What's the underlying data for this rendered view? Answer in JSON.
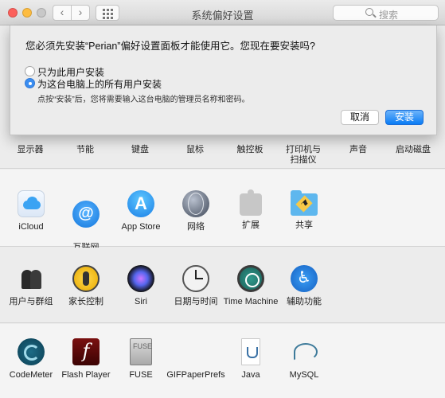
{
  "window": {
    "title": "系统偏好设置",
    "search_placeholder": "搜索"
  },
  "nav": {
    "back": "‹",
    "forward": "›"
  },
  "dialog": {
    "message": "您必须先安装“Perian”偏好设置面板才能使用它。您现在要安装吗?",
    "option_current_user": "只为此用户安装",
    "option_all_users": "为这台电脑上的所有用户安装",
    "selected": "all_users",
    "hint": "点按“安装”后，您将需要输入这台电脑的管理员名称和密码。",
    "cancel": "取消",
    "install": "安装"
  },
  "row1": [
    "显示器",
    "节能",
    "键盘",
    "鼠标",
    "触控板",
    "打印机与\n扫描仪",
    "声音",
    "启动磁盘"
  ],
  "row2": [
    {
      "label": "iCloud",
      "icon": "icloud-icon"
    },
    {
      "label": "互联网\n帐户",
      "icon": "internet-accounts-icon",
      "glyph": "@"
    },
    {
      "label": "App Store",
      "icon": "app-store-icon",
      "glyph": "A"
    },
    {
      "label": "网络",
      "icon": "network-icon"
    },
    {
      "label": "扩展",
      "icon": "extensions-icon"
    },
    {
      "label": "共享",
      "icon": "sharing-icon"
    }
  ],
  "row3": [
    {
      "label": "用户与群组",
      "icon": "users-groups-icon"
    },
    {
      "label": "家长控制",
      "icon": "parental-controls-icon"
    },
    {
      "label": "Siri",
      "icon": "siri-icon"
    },
    {
      "label": "日期与时间",
      "icon": "date-time-icon"
    },
    {
      "label": "Time Machine",
      "icon": "time-machine-icon"
    },
    {
      "label": "辅助功能",
      "icon": "accessibility-icon",
      "glyph": "♿"
    }
  ],
  "row4": [
    {
      "label": "CodeMeter",
      "icon": "codemeter-icon"
    },
    {
      "label": "Flash Player",
      "icon": "flash-player-icon",
      "glyph": "f"
    },
    {
      "label": "FUSE",
      "icon": "fuse-icon",
      "glyph": "FUSE"
    },
    {
      "label": "GIFPaperPrefs",
      "icon": "gifpaperprefs-icon"
    },
    {
      "label": "Java",
      "icon": "java-icon"
    },
    {
      "label": "MySQL",
      "icon": "mysql-icon"
    }
  ]
}
